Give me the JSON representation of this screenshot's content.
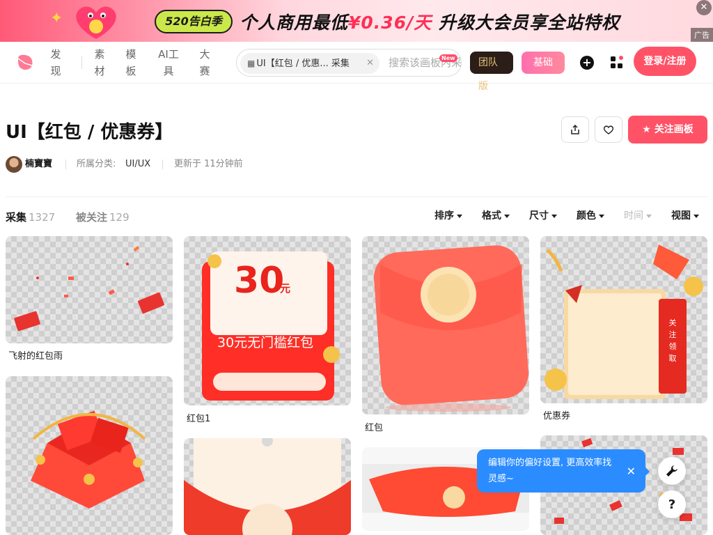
{
  "banner": {
    "badge_text": "520告白季",
    "promo_prefix": "个人商用最低",
    "promo_price": "¥0.36/天",
    "promo_suffix": "升级大会员享全站特权",
    "ad_label": "广告",
    "close_glyph": "✕"
  },
  "nav": {
    "items": [
      "发现",
      "素材",
      "模板",
      "AI工具",
      "大赛"
    ],
    "search_chip_label": "UI【红包 / 优惠... 采集",
    "search_placeholder": "搜索该画板内采集",
    "new_badge": "New",
    "team_label": "团队",
    "team_suffix": "版",
    "basic_label": "基础",
    "login_label": "登录/注册"
  },
  "board": {
    "title": "UI【红包 / 优惠券】",
    "author": "楠寶寶",
    "category_label": "所属分类:",
    "category_value": "UI/UX",
    "updated": "更新于 11分钟前",
    "follow_label": "关注画板"
  },
  "tabs": [
    {
      "label": "采集",
      "count": "1327"
    },
    {
      "label": "被关注",
      "count": "129"
    }
  ],
  "filters": [
    {
      "label": "排序",
      "disabled": false
    },
    {
      "label": "格式",
      "disabled": false
    },
    {
      "label": "尺寸",
      "disabled": false
    },
    {
      "label": "颜色",
      "disabled": false
    },
    {
      "label": "时间",
      "disabled": true
    },
    {
      "label": "视图",
      "disabled": false
    }
  ],
  "cards": [
    {
      "caption": "飞射的红包雨"
    },
    {
      "caption": "红包1",
      "amount": "30",
      "unit": "元",
      "envelope_text": "30元无门槛红包"
    },
    {
      "caption": "红包"
    },
    {
      "caption": "优惠券",
      "tag_text": "关注领取"
    },
    {
      "caption": ""
    },
    {
      "caption": ""
    },
    {
      "caption": ""
    },
    {
      "caption": ""
    }
  ],
  "toast": {
    "message": "编辑你的偏好设置, 更高效率找灵感~",
    "close_glyph": "✕"
  },
  "helpers": {
    "help_glyph": "?"
  },
  "colors": {
    "brand": "#ff5267",
    "toast_blue": "#2b8cff",
    "team_dark": "#2b1d17",
    "team_gold": "#e8c27a"
  }
}
